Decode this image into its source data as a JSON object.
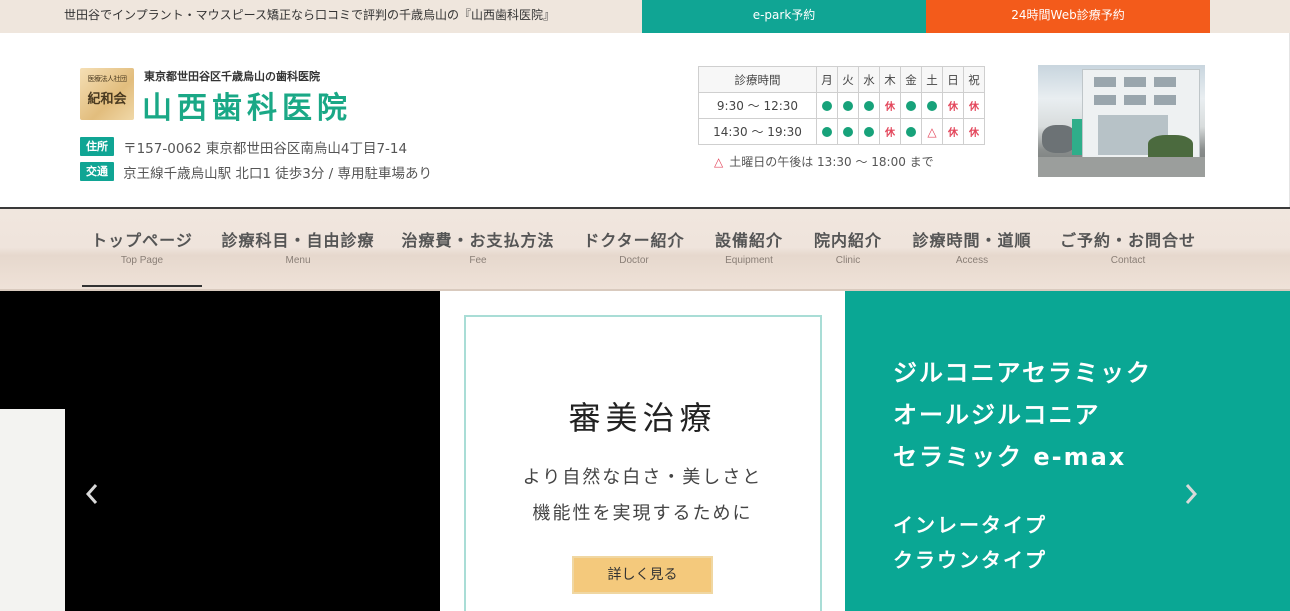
{
  "topbar": {
    "tagline": "世田谷でインプラント・マウスピース矯正なら口コミで評判の千歳烏山の『山西歯科医院』",
    "epark_label": "e-park予約",
    "web_label": "24時間Web診療予約",
    "colors": {
      "epark": "#10a594",
      "web": "#f35b1b"
    }
  },
  "header": {
    "logo": {
      "small": "医療法人社団",
      "big": "紀和会"
    },
    "clinic_sub": "東京都世田谷区千歳烏山の歯科医院",
    "clinic_name": "山西歯科医院",
    "address": {
      "tag": "住所",
      "text": "〒157-0062 東京都世田谷区南烏山4丁目7-14"
    },
    "access": {
      "tag": "交通",
      "text": "京王線千歳烏山駅 北口1 徒歩3分 / 専用駐車場あり"
    },
    "accent_color": "#1aa886"
  },
  "hours": {
    "head": "診療時間",
    "days": [
      "月",
      "火",
      "水",
      "木",
      "金",
      "土",
      "日",
      "祝"
    ],
    "rows": [
      {
        "time": "9:30 〜 12:30",
        "cells": [
          "dot",
          "dot",
          "dot",
          "休",
          "dot",
          "dot",
          "休",
          "休"
        ]
      },
      {
        "time": "14:30 〜 19:30",
        "cells": [
          "dot",
          "dot",
          "dot",
          "休",
          "dot",
          "△",
          "休",
          "休"
        ]
      }
    ],
    "note_mark": "△",
    "note": "土曜日の午後は 13:30 〜 18:00 まで"
  },
  "nav": {
    "items": [
      {
        "label": "トップページ",
        "sub": "Top Page"
      },
      {
        "label": "診療科目・自由診療",
        "sub": "Menu"
      },
      {
        "label": "治療費・お支払方法",
        "sub": "Fee"
      },
      {
        "label": "ドクター紹介",
        "sub": "Doctor"
      },
      {
        "label": "設備紹介",
        "sub": "Equipment"
      },
      {
        "label": "院内紹介",
        "sub": "Clinic"
      },
      {
        "label": "診療時間・道順",
        "sub": "Access"
      },
      {
        "label": "ご予約・お問合せ",
        "sub": "Contact"
      }
    ],
    "active_index": 0
  },
  "slider": {
    "title": "審美治療",
    "text1": "より自然な白さ・美しさと",
    "text2": "機能性を実現するために",
    "button": "詳しく見る",
    "right_lines": [
      "ジルコニアセラミック",
      "オールジルコニア",
      "セラミック e-max"
    ],
    "right_lines2": [
      "インレータイプ",
      "クラウンタイプ"
    ],
    "prev_icon": "chevron-left-icon",
    "next_icon": "chevron-right-icon",
    "accent_color": "#0aa794"
  }
}
